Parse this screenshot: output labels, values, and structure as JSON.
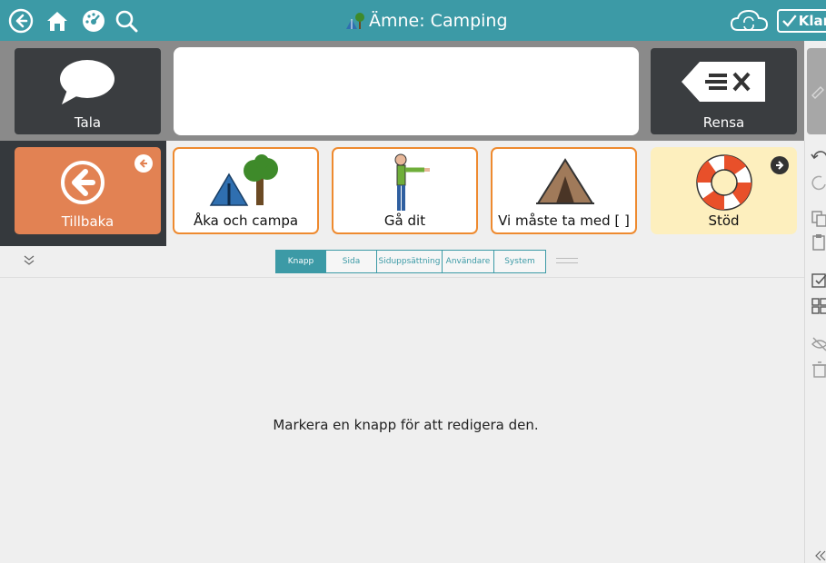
{
  "header": {
    "title": "Ämne: Camping",
    "done_label": "Klar",
    "icons": [
      "back-circle-icon",
      "home-icon",
      "dashboard-icon",
      "search-icon",
      "cloud-sync-icon",
      "checkmark-icon"
    ]
  },
  "message_bar": {
    "speak_label": "Tala",
    "clear_label": "Rensa",
    "text": ""
  },
  "buttons": [
    {
      "label": "Tillbaka",
      "icon": "back-arrow-icon",
      "kind": "back"
    },
    {
      "label": "Åka och campa",
      "icon": "tent-tree-icon",
      "kind": "card"
    },
    {
      "label": "Gå dit",
      "icon": "person-pointing-icon",
      "kind": "card"
    },
    {
      "label": "Vi måste ta med [  ]",
      "icon": "tent-icon",
      "kind": "card"
    },
    {
      "label": "Stöd",
      "icon": "lifebuoy-icon",
      "kind": "nav"
    }
  ],
  "inspector": {
    "tabs": [
      {
        "label": "Knapp",
        "active": true
      },
      {
        "label": "Sida",
        "active": false
      },
      {
        "label": "Siduppsättning",
        "active": false
      },
      {
        "label": "Användare",
        "active": false
      },
      {
        "label": "System",
        "active": false
      }
    ],
    "hint": "Markera en knapp för att redigera den."
  },
  "colors": {
    "teal": "#3c9aa6",
    "back_orange": "#e28253",
    "card_border": "#ee8a2f",
    "nav_yellow": "#fdefbe",
    "dark": "#3a3d40"
  }
}
